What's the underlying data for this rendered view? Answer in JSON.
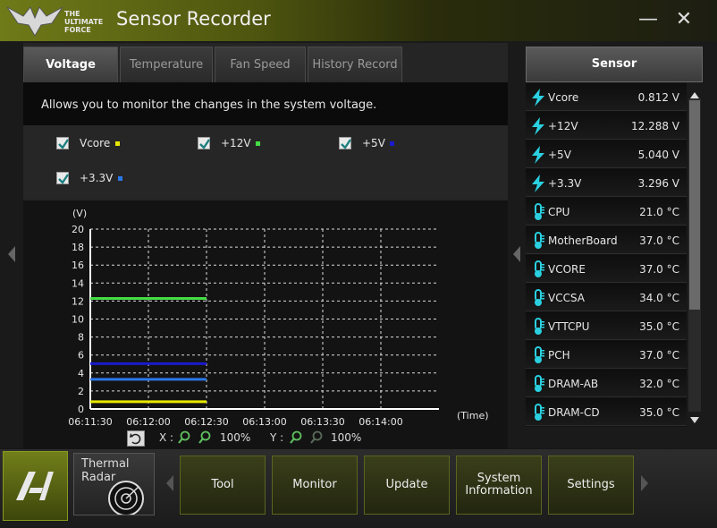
{
  "window": {
    "title": "Sensor Recorder",
    "minimize_glyph": "—",
    "close_glyph": "✕"
  },
  "logo": {
    "line1": "THE",
    "line2": "ULTIMATE",
    "line3": "FORCE",
    "icon": "tuf-wings-icon"
  },
  "tabs": [
    {
      "label": "Voltage",
      "active": true
    },
    {
      "label": "Temperature",
      "active": false
    },
    {
      "label": "Fan Speed",
      "active": false
    },
    {
      "label": "History Record",
      "active": false
    }
  ],
  "description": "Allows you to monitor the changes in the system voltage.",
  "checks": [
    {
      "label": "Vcore",
      "checked": true,
      "color": "#e8e800"
    },
    {
      "label": "+12V",
      "checked": true,
      "color": "#44dd44"
    },
    {
      "label": "+5V",
      "checked": true,
      "color": "#1a1acc"
    },
    {
      "label": "+3.3V",
      "checked": true,
      "color": "#2a78e8"
    }
  ],
  "chart_data": {
    "type": "line",
    "ylabel": "(V)",
    "xlabel": "(Time)",
    "ylim": [
      0,
      20
    ],
    "yticks": [
      0,
      2,
      4,
      6,
      8,
      10,
      12,
      14,
      16,
      18,
      20
    ],
    "xticks": [
      "06:11:30",
      "06:12:00",
      "06:12:30",
      "06:13:00",
      "06:13:30",
      "06:14:00"
    ],
    "grid": true,
    "series": [
      {
        "name": "Vcore",
        "color": "#e8e800",
        "x": [
          "06:11:30",
          "06:12:30"
        ],
        "values": [
          0.812,
          0.812
        ]
      },
      {
        "name": "+12V",
        "color": "#44dd44",
        "x": [
          "06:11:30",
          "06:12:30"
        ],
        "values": [
          12.288,
          12.288
        ]
      },
      {
        "name": "+5V",
        "color": "#1a1acc",
        "x": [
          "06:11:30",
          "06:12:30"
        ],
        "values": [
          5.04,
          5.04
        ]
      },
      {
        "name": "+3.3V",
        "color": "#2a78e8",
        "x": [
          "06:11:30",
          "06:12:30"
        ],
        "values": [
          3.296,
          3.296
        ]
      }
    ]
  },
  "zoom": {
    "x_label": "X :",
    "x_value": "100%",
    "y_label": "Y :",
    "y_value": "100%"
  },
  "sensor": {
    "header": "Sensor",
    "items": [
      {
        "name": "Vcore",
        "value": "0.812  V",
        "kind": "voltage"
      },
      {
        "name": "+12V",
        "value": "12.288  V",
        "kind": "voltage"
      },
      {
        "name": "+5V",
        "value": "5.040  V",
        "kind": "voltage"
      },
      {
        "name": "+3.3V",
        "value": "3.296  V",
        "kind": "voltage"
      },
      {
        "name": "CPU",
        "value": "21.0 °C",
        "kind": "temp"
      },
      {
        "name": "MotherBoard",
        "value": "37.0 °C",
        "kind": "temp"
      },
      {
        "name": "VCORE",
        "value": "37.0 °C",
        "kind": "temp"
      },
      {
        "name": "VCCSA",
        "value": "34.0 °C",
        "kind": "temp"
      },
      {
        "name": "VTTCPU",
        "value": "35.0 °C",
        "kind": "temp"
      },
      {
        "name": "PCH",
        "value": "37.0 °C",
        "kind": "temp"
      },
      {
        "name": "DRAM-AB",
        "value": "32.0 °C",
        "kind": "temp"
      },
      {
        "name": "DRAM-CD",
        "value": "35.0 °C",
        "kind": "temp"
      }
    ]
  },
  "bottom": {
    "ai_logo": "AI",
    "thermal_line1": "Thermal",
    "thermal_line2": "Radar",
    "buttons": [
      "Tool",
      "Monitor",
      "Update",
      "System Information",
      "Settings"
    ]
  },
  "colors": {
    "accent": "#6f7a18",
    "voltage_icon": "#2ad0e0",
    "temp_icon": "#2ad0e0"
  }
}
